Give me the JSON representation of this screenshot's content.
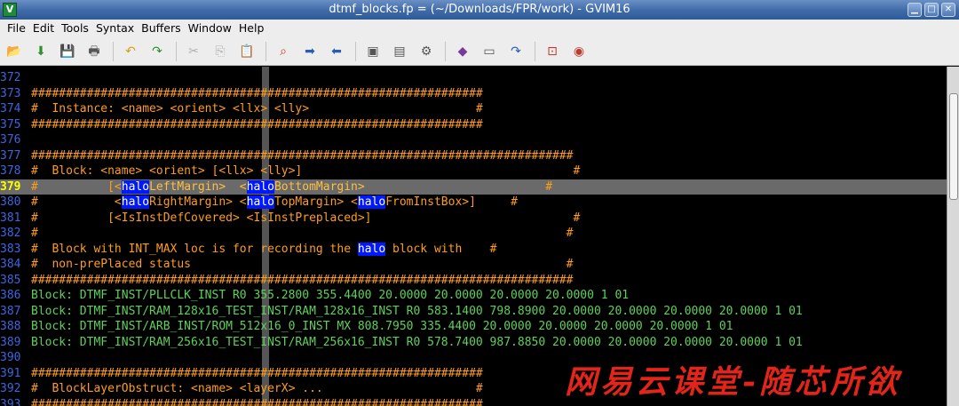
{
  "window": {
    "title": "dtmf_blocks.fp = (~/Downloads/FPR/work) - GVIM16",
    "app_icon": "gvim-icon",
    "buttons": [
      "minimize",
      "maximize",
      "close"
    ]
  },
  "menu": [
    "File",
    "Edit",
    "Tools",
    "Syntax",
    "Buffers",
    "Window",
    "Help"
  ],
  "toolbar": [
    {
      "name": "open-file-icon",
      "glyph": "📂",
      "color": "#3a6fb5"
    },
    {
      "name": "save-download-icon",
      "glyph": "⬇",
      "color": "#2f8f2f"
    },
    {
      "name": "save-icon",
      "glyph": "💾",
      "color": "#3a6fb5"
    },
    {
      "name": "print-icon",
      "glyph": "🖶",
      "color": "#555555"
    },
    {
      "sep": true
    },
    {
      "name": "undo-icon",
      "glyph": "↶",
      "color": "#d4a017"
    },
    {
      "name": "redo-icon",
      "glyph": "↷",
      "color": "#2f8f2f"
    },
    {
      "sep": true
    },
    {
      "name": "cut-icon",
      "glyph": "✂",
      "color": "#b0b0b0"
    },
    {
      "name": "copy-icon",
      "glyph": "⎘",
      "color": "#b0b0b0"
    },
    {
      "name": "paste-icon",
      "glyph": "📋",
      "color": "#8a6a3a"
    },
    {
      "sep": true
    },
    {
      "name": "find-replace-icon",
      "glyph": "⌕",
      "color": "#c0392b"
    },
    {
      "name": "find-next-icon",
      "glyph": "➡",
      "color": "#2a5db0"
    },
    {
      "name": "find-prev-icon",
      "glyph": "⬅",
      "color": "#2a5db0"
    },
    {
      "sep": true
    },
    {
      "name": "load-session-icon",
      "glyph": "▣",
      "color": "#555555"
    },
    {
      "name": "save-session-icon",
      "glyph": "▤",
      "color": "#555555"
    },
    {
      "name": "run-script-icon",
      "glyph": "⚙",
      "color": "#555555"
    },
    {
      "sep": true
    },
    {
      "name": "make-icon",
      "glyph": "◆",
      "color": "#7a3a9a"
    },
    {
      "name": "shell-icon",
      "glyph": "▭",
      "color": "#555555"
    },
    {
      "name": "jump-tag-icon",
      "glyph": "↷",
      "color": "#2a5db0"
    },
    {
      "sep": true
    },
    {
      "name": "help-icon",
      "glyph": "⊡",
      "color": "#c0392b"
    },
    {
      "name": "find-help-icon",
      "glyph": "◉",
      "color": "#c0392b"
    }
  ],
  "editor": {
    "cursor_line": 379,
    "lines": [
      {
        "n": "372",
        "kind": "comment",
        "parts": [
          {
            "t": ""
          }
        ]
      },
      {
        "n": "373",
        "kind": "comment",
        "parts": [
          {
            "t": "#################################################################"
          }
        ]
      },
      {
        "n": "374",
        "kind": "comment",
        "parts": [
          {
            "t": "#  Instance: <name> <orient> <llx> <lly>                        #"
          }
        ]
      },
      {
        "n": "375",
        "kind": "comment",
        "parts": [
          {
            "t": "#################################################################"
          }
        ]
      },
      {
        "n": "376",
        "kind": "comment",
        "parts": [
          {
            "t": ""
          }
        ]
      },
      {
        "n": "377",
        "kind": "comment",
        "parts": [
          {
            "t": "##############################################################################"
          }
        ]
      },
      {
        "n": "378",
        "kind": "comment",
        "parts": [
          {
            "t": "#  Block: <name> <orient> [<llx> <lly>]                                       #"
          }
        ]
      },
      {
        "n": "379",
        "kind": "comment",
        "parts": [
          {
            "t": "#          [<"
          },
          {
            "t": "halo",
            "k": true
          },
          {
            "t": "LeftMargin>  <",
            "r": true
          },
          {
            "t": "halo",
            "k": true
          },
          {
            "t": "BottomMargin>",
            "r": true
          },
          {
            "t": "                          #"
          }
        ]
      },
      {
        "n": "380",
        "kind": "comment",
        "parts": [
          {
            "t": "#           <"
          },
          {
            "t": "halo",
            "k": true
          },
          {
            "t": "RightMargin> <"
          },
          {
            "t": "halo",
            "k": true
          },
          {
            "t": "TopMargin> <"
          },
          {
            "t": "halo",
            "k": true
          },
          {
            "t": "FromInstBox>]     #"
          }
        ]
      },
      {
        "n": "381",
        "kind": "comment",
        "parts": [
          {
            "t": "#          [<IsInstDefCovered> <IsInstPreplaced>]                             #"
          }
        ]
      },
      {
        "n": "382",
        "kind": "comment",
        "parts": [
          {
            "t": "#                                                                            #"
          }
        ]
      },
      {
        "n": "383",
        "kind": "comment",
        "parts": [
          {
            "t": "#  Block with INT_MAX loc is for recording the "
          },
          {
            "t": "halo",
            "k": true
          },
          {
            "t": " block with    #"
          }
        ]
      },
      {
        "n": "384",
        "kind": "comment",
        "parts": [
          {
            "t": "#  non-prePlaced status                                                      #"
          }
        ]
      },
      {
        "n": "385",
        "kind": "comment",
        "parts": [
          {
            "t": "##############################################################################"
          }
        ]
      },
      {
        "n": "386",
        "kind": "code",
        "parts": [
          {
            "t": "Block: DTMF_INST/PLLCLK_INST R0 355.2800 355.4400 20.0000 20.0000 20.0000 20.0000 1 01"
          }
        ]
      },
      {
        "n": "387",
        "kind": "code",
        "parts": [
          {
            "t": "Block: DTMF_INST/RAM_128x16_TEST_INST/RAM_128x16_INST R0 583.1400 798.8900 20.0000 20.0000 20.0000 20.0000 1 01"
          }
        ]
      },
      {
        "n": "388",
        "kind": "code",
        "parts": [
          {
            "t": "Block: DTMF_INST/ARB_INST/ROM_512x16_0_INST MX 808.7950 335.4400 20.0000 20.0000 20.0000 20.0000 1 01"
          }
        ]
      },
      {
        "n": "389",
        "kind": "code",
        "parts": [
          {
            "t": "Block: DTMF_INST/RAM_256x16_TEST_INST/RAM_256x16_INST R0 578.7400 987.8850 20.0000 20.0000 20.0000 20.0000 1 01"
          }
        ]
      },
      {
        "n": "390",
        "kind": "comment",
        "parts": [
          {
            "t": ""
          }
        ]
      },
      {
        "n": "391",
        "kind": "comment",
        "parts": [
          {
            "t": "#################################################################"
          }
        ]
      },
      {
        "n": "392",
        "kind": "comment",
        "parts": [
          {
            "t": "#  BlockLayerObstruct: <name> <layerX> ...                      #"
          }
        ]
      },
      {
        "n": "393",
        "kind": "comment",
        "parts": [
          {
            "t": "#################################################################"
          }
        ]
      }
    ]
  },
  "watermark": "网易云课堂-随芯所欲",
  "colors": {
    "comment": "#ff9e1a",
    "code": "#5fd15a",
    "line_number": "#3a66e0",
    "search_highlight": "#0018ff"
  }
}
